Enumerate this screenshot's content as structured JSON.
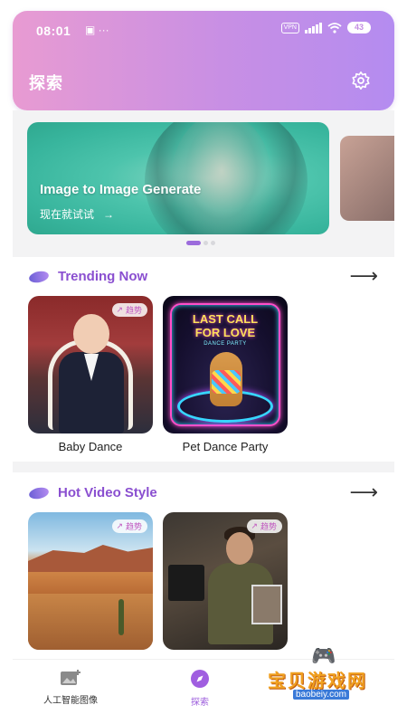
{
  "status_bar": {
    "time": "08:01",
    "left_icons": "▣ ···",
    "vpn": "VPN",
    "battery": "43"
  },
  "header": {
    "title": "探索",
    "settings_icon": "gear-icon"
  },
  "banner": {
    "title": "Image to Image Generate",
    "subtitle": "现在就试试",
    "arrow": "→",
    "active_page": 1,
    "pages": 3
  },
  "sections": [
    {
      "title": "Trending Now",
      "arrow": "⟶",
      "cards": [
        {
          "label": "Baby Dance",
          "tag": "趋势"
        },
        {
          "label": "Pet Dance Party",
          "tag": "",
          "art_text_1": "LAST CALL",
          "art_text_2": "FOR LOVE",
          "art_text_3": "DANCE PARTY"
        }
      ]
    },
    {
      "title": "Hot Video Style",
      "arrow": "⟶",
      "cards": [
        {
          "label": "",
          "tag": "趋势"
        },
        {
          "label": "",
          "tag": "趋势"
        }
      ]
    }
  ],
  "tabbar": {
    "items": [
      {
        "label": "人工智能图像",
        "icon": "image-add-icon"
      },
      {
        "label": "探索",
        "icon": "compass-icon",
        "active": true
      }
    ]
  },
  "watermark": {
    "text": "宝贝游戏网",
    "url": "baobeiy.com"
  },
  "colors": {
    "accent": "#9c5cdc",
    "header_start": "#e89bd2",
    "header_end": "#b48cf0",
    "section_title": "#8a4fd0"
  }
}
